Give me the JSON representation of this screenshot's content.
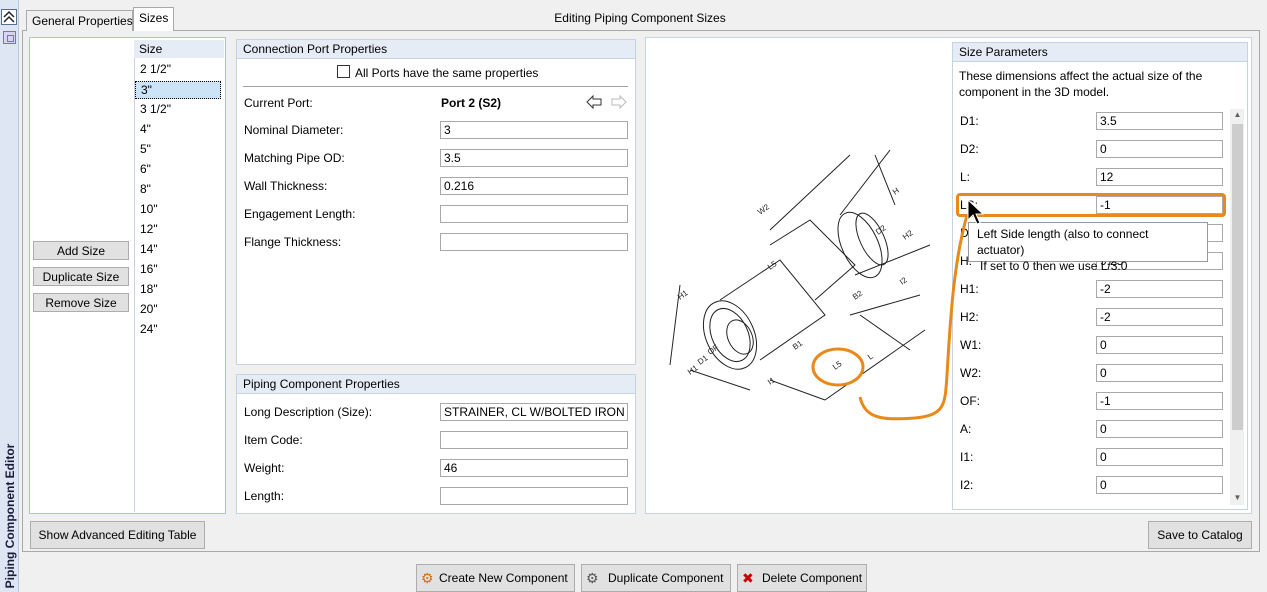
{
  "sidebar": {
    "vertical_title": "Piping Component Editor"
  },
  "tabs": [
    {
      "label": "General Properties"
    },
    {
      "label": "Sizes"
    }
  ],
  "window_title": "Editing Piping Component Sizes",
  "sizes": {
    "header": "Size",
    "items": [
      "2 1/2\"",
      "3\"",
      "3 1/2\"",
      "4\"",
      "5\"",
      "6\"",
      "8\"",
      "10\"",
      "12\"",
      "14\"",
      "16\"",
      "18\"",
      "20\"",
      "24\""
    ],
    "selected_index": 1,
    "add_label": "Add Size",
    "duplicate_label": "Duplicate Size",
    "remove_label": "Remove Size"
  },
  "connection": {
    "header": "Connection Port Properties",
    "same_props_label": "All Ports have the same properties",
    "current_port_label": "Current Port:",
    "current_port_value": "Port 2 (S2)",
    "fields": [
      {
        "label": "Nominal Diameter:",
        "value": "3"
      },
      {
        "label": "Matching Pipe OD:",
        "value": "3.5"
      },
      {
        "label": "Wall Thickness:",
        "value": "0.216"
      },
      {
        "label": "Engagement Length:",
        "value": ""
      },
      {
        "label": "Flange Thickness:",
        "value": ""
      }
    ]
  },
  "component": {
    "header": "Piping Component Properties",
    "fields": [
      {
        "label": "Long Description (Size):",
        "value": "STRAINER, CL W/BOLTED IRON CA"
      },
      {
        "label": "Item Code:",
        "value": ""
      },
      {
        "label": "Weight:",
        "value": "46"
      },
      {
        "label": "Length:",
        "value": ""
      }
    ]
  },
  "drawing": {
    "labels": [
      "W2",
      "H",
      "D2",
      "H2",
      "L5",
      "H1",
      "I2",
      "B2",
      "OF",
      "D1",
      "H1",
      "B1",
      "L",
      "I1",
      "L5"
    ]
  },
  "size_params": {
    "header": "Size Parameters",
    "description": "These dimensions affect the actual size of the component in the 3D model.",
    "params": [
      {
        "label": "D1:",
        "value": "3.5"
      },
      {
        "label": "D2:",
        "value": "0"
      },
      {
        "label": "L:",
        "value": "12"
      },
      {
        "label": "LS:",
        "value": "-1"
      },
      {
        "label": "D",
        "value": ""
      },
      {
        "label": "H:",
        "value": "9.25"
      },
      {
        "label": "H1:",
        "value": "-2"
      },
      {
        "label": "H2:",
        "value": "-2"
      },
      {
        "label": "W1:",
        "value": "0"
      },
      {
        "label": "W2:",
        "value": "0"
      },
      {
        "label": "OF:",
        "value": "-1"
      },
      {
        "label": "A:",
        "value": "0"
      },
      {
        "label": "I1:",
        "value": "0"
      },
      {
        "label": "I2:",
        "value": "0"
      }
    ],
    "tooltip_line1": "Left Side length (also to connect actuator)",
    "tooltip_line2": "If set to 0 then we use L/3.0"
  },
  "footer": {
    "advanced_label": "Show Advanced Editing Table",
    "save_label": "Save to Catalog",
    "create_label": "Create New Component",
    "duplicate_label": "Duplicate Component",
    "delete_label": "Delete Component"
  },
  "colors": {
    "highlight": "#e8891a",
    "selection": "#cce4f7",
    "header_bg": "#e6ecf5"
  }
}
